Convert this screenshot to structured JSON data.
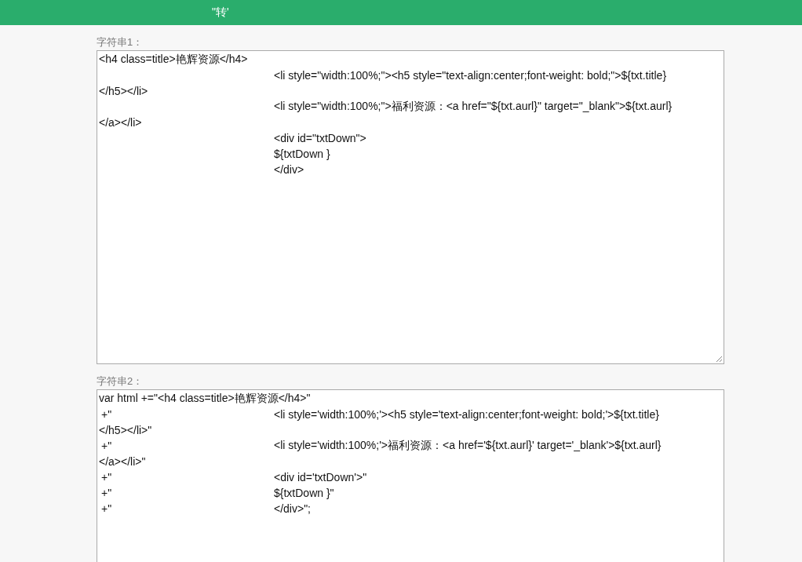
{
  "header": {
    "title": "\"转'"
  },
  "fields": [
    {
      "label": "字符串1：",
      "lines": [
        {
          "kind": "plain",
          "text": "<h4 class=title>艳辉资源</h4>"
        },
        {
          "kind": "indented",
          "text": "<li style=\"width:100%;\"><h5 style=\"text-align:center;font-weight: bold;\">${txt.title}"
        },
        {
          "kind": "plain",
          "text": "</h5></li>"
        },
        {
          "kind": "indented",
          "text": "<li style=\"width:100%;\">福利资源：<a href=\"${txt.aurl}\" target=\"_blank\">${txt.aurl}"
        },
        {
          "kind": "plain",
          "text": "</a></li>"
        },
        {
          "kind": "indented",
          "text": "<div id=\"txtDown\">"
        },
        {
          "kind": "indented",
          "text": "${txtDown }"
        },
        {
          "kind": "indented",
          "text": "</div>"
        }
      ]
    },
    {
      "label": "字符串2：",
      "lines": [
        {
          "kind": "plain",
          "text": "var html +=\"<h4 class=title>艳辉资源</h4>\""
        },
        {
          "kind": "indented",
          "prefix": "+\"",
          "text": "<li style='width:100%;'><h5 style='text-align:center;font-weight: bold;'>${txt.title}"
        },
        {
          "kind": "plain",
          "text": "</h5></li>\""
        },
        {
          "kind": "indented",
          "prefix": "+\"",
          "text": "<li style='width:100%;'>福利资源：<a href='${txt.aurl}' target='_blank'>${txt.aurl}"
        },
        {
          "kind": "plain",
          "text": "</a></li>\""
        },
        {
          "kind": "indented",
          "prefix": "+\"",
          "text": "<div id='txtDown'>\""
        },
        {
          "kind": "indented",
          "prefix": "+\"",
          "text": "${txtDown }\""
        },
        {
          "kind": "indented",
          "prefix": "+\"",
          "text": "</div>\";"
        }
      ]
    }
  ]
}
